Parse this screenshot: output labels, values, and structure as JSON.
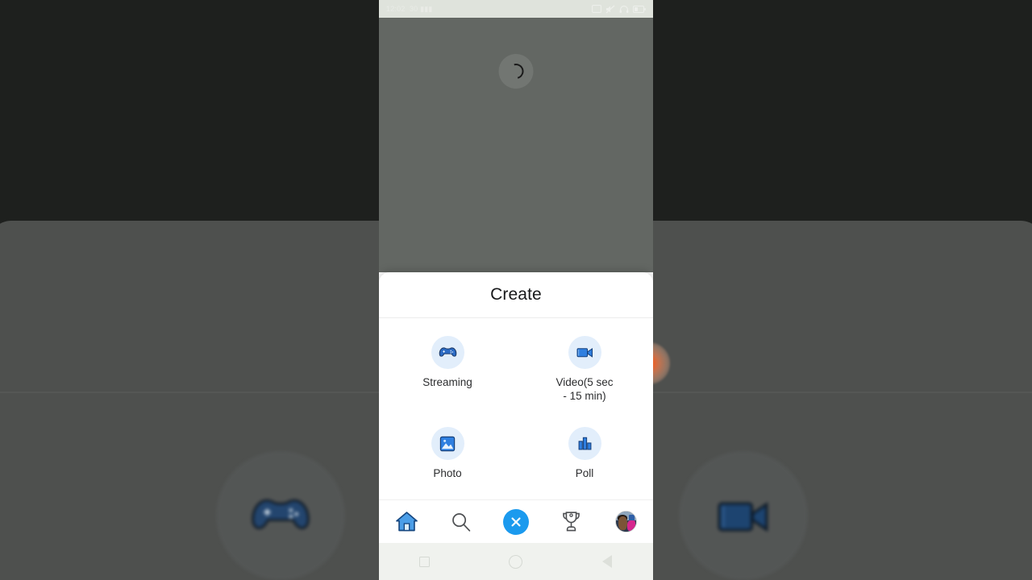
{
  "phone": {
    "status_bar": {
      "time": "12:02",
      "battery_pct": "30",
      "icons": [
        "sim-icon",
        "mute-icon",
        "headphones-icon",
        "battery-icon"
      ]
    },
    "loading": {
      "spinner_name": "loading-spinner"
    },
    "create_sheet": {
      "title": "Create",
      "options": [
        {
          "id": "streaming",
          "label": "Streaming",
          "icon": "gamepad-icon"
        },
        {
          "id": "video",
          "label": "Video(5 sec - 15 min)",
          "icon": "video-camera-icon"
        },
        {
          "id": "photo",
          "label": "Photo",
          "icon": "image-icon"
        },
        {
          "id": "poll",
          "label": "Poll",
          "icon": "bar-chart-icon"
        }
      ]
    },
    "bottom_nav": [
      {
        "id": "home",
        "icon": "home-icon",
        "label": "Home",
        "active": true
      },
      {
        "id": "search",
        "icon": "search-icon",
        "label": "Search",
        "active": false
      },
      {
        "id": "close",
        "icon": "close-icon",
        "label": "Close",
        "active": false
      },
      {
        "id": "trophy",
        "icon": "trophy-icon",
        "label": "Rewards",
        "active": false
      },
      {
        "id": "profile",
        "icon": "avatar-icon",
        "label": "Profile",
        "active": false
      }
    ],
    "system_nav": [
      {
        "id": "recents",
        "icon": "square-icon",
        "label": "Recents"
      },
      {
        "id": "home",
        "icon": "circle-icon",
        "label": "Home"
      },
      {
        "id": "back",
        "icon": "triangle-left-icon",
        "label": "Back"
      }
    ]
  },
  "background": {
    "icons": [
      {
        "id": "bg-gamepad",
        "icon": "gamepad-icon"
      },
      {
        "id": "bg-video",
        "icon": "video-camera-icon"
      }
    ],
    "blob": {
      "id": "orange-glow",
      "color": "#e8632c"
    }
  },
  "colors": {
    "accent_blue": "#1b9aee",
    "icon_blue": "#2f6fd0",
    "bubble_bg": "#e2eefb",
    "sheet_bg": "#ffffff",
    "screen_gray": "#636763",
    "status_bar_bg": "#dfe3dc",
    "sysnav_bg": "#f0f2ee"
  }
}
